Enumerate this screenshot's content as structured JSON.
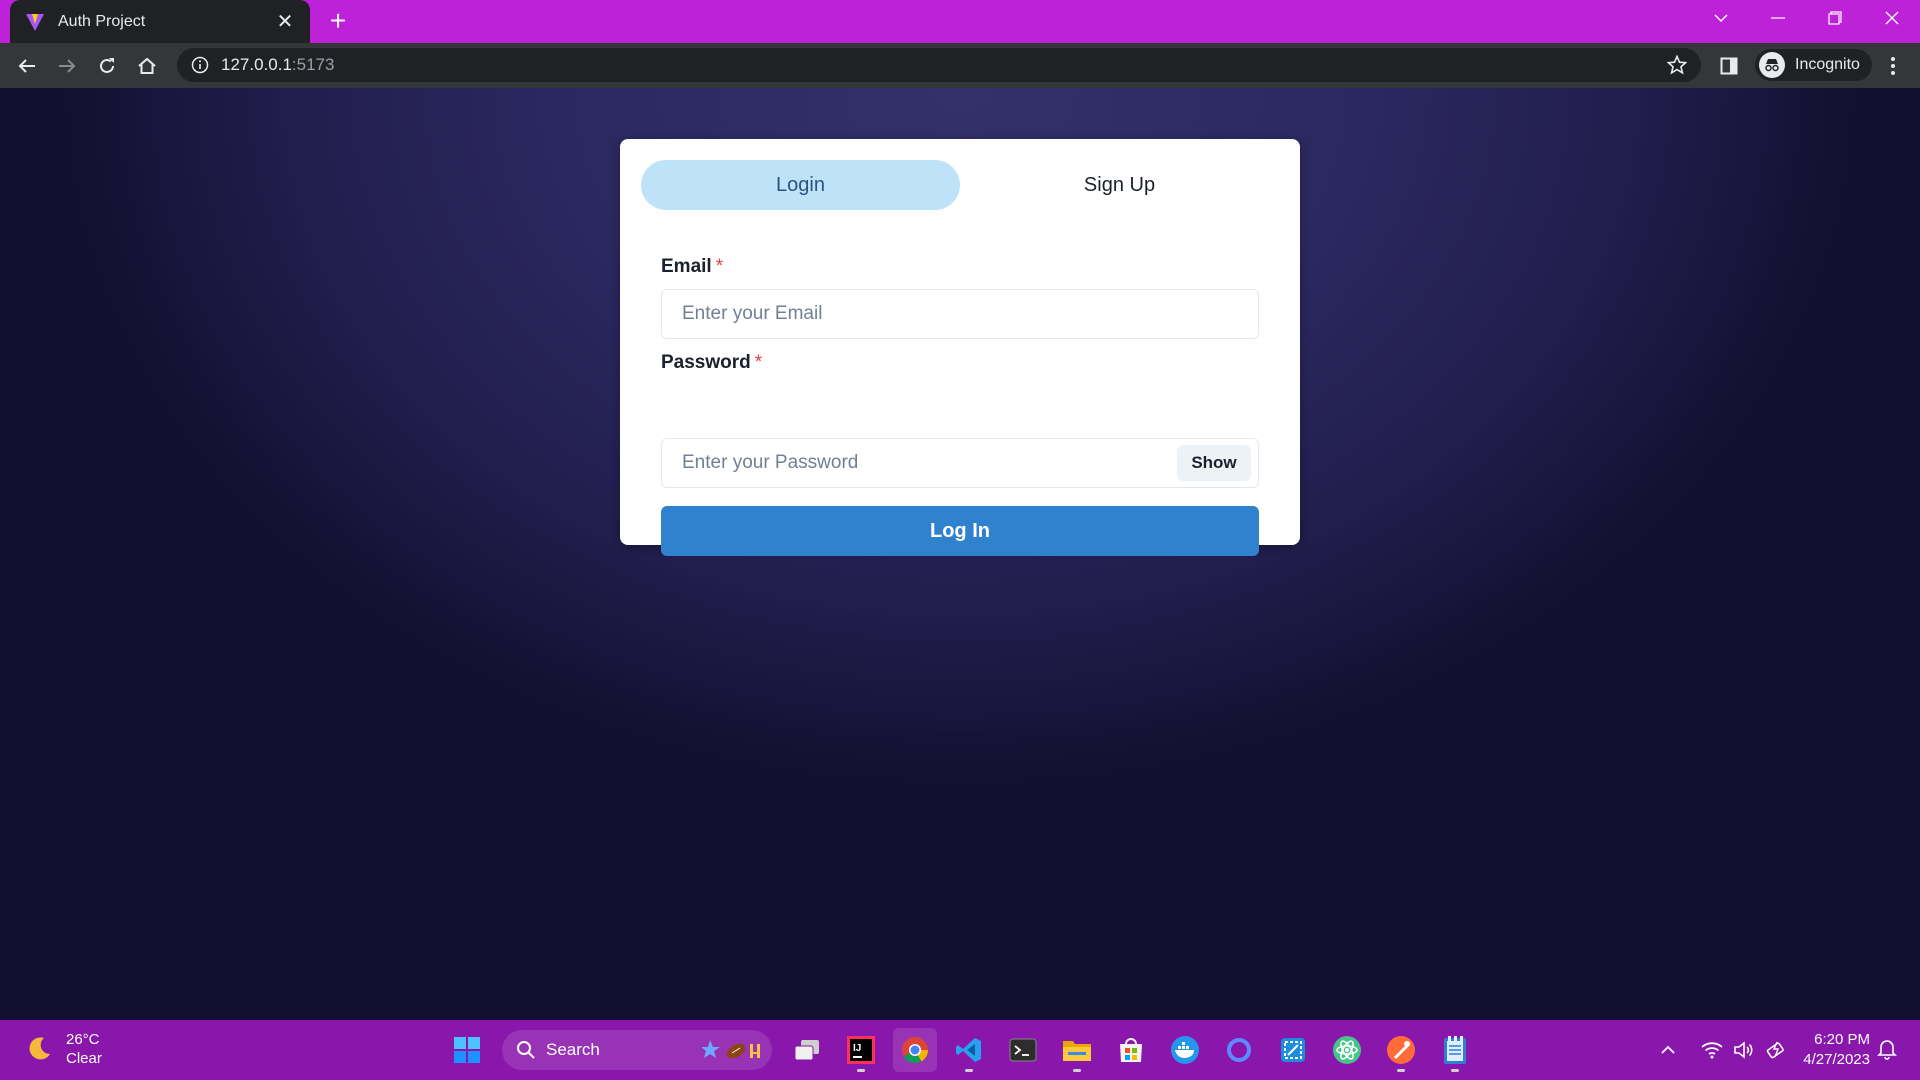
{
  "browser": {
    "tab_title": "Auth Project",
    "url_host": "127.0.0.1",
    "url_port": ":5173",
    "profile_label": "Incognito"
  },
  "auth": {
    "tabs": [
      {
        "label": "Login",
        "active": true
      },
      {
        "label": "Sign Up",
        "active": false
      }
    ],
    "email_label": "Email",
    "email_placeholder": "Enter your Email",
    "password_label": "Password",
    "password_placeholder": "Enter your Password",
    "required_mark": "*",
    "show_label": "Show",
    "submit_label": "Log In",
    "colors": {
      "active_tab_bg": "#bee3f8",
      "primary": "#3182ce",
      "required": "#e53e3e"
    }
  },
  "taskbar": {
    "weather_temp": "26°C",
    "weather_cond": "Clear",
    "search_label": "Search",
    "time": "6:20 PM",
    "date": "4/27/2023"
  },
  "icons": [
    "vite-logo-icon",
    "close-icon",
    "plus-icon",
    "chevron-down-icon",
    "minimize-icon",
    "restore-icon",
    "back-icon",
    "forward-icon",
    "reload-icon",
    "home-icon",
    "info-icon",
    "star-icon",
    "sidebar-icon",
    "incognito-icon",
    "menu-icon",
    "moon-icon",
    "windows-start-icon",
    "search-icon",
    "task-view-icon",
    "intellij-icon",
    "chrome-icon",
    "vscode-icon",
    "terminal-icon",
    "file-explorer-icon",
    "ms-store-icon",
    "docker-icon",
    "cortana-icon",
    "snipping-icon",
    "electron-icon",
    "postman-icon",
    "notepad-icon",
    "chevron-up-icon",
    "wifi-icon",
    "volume-icon",
    "battery-icon",
    "notification-icon"
  ]
}
